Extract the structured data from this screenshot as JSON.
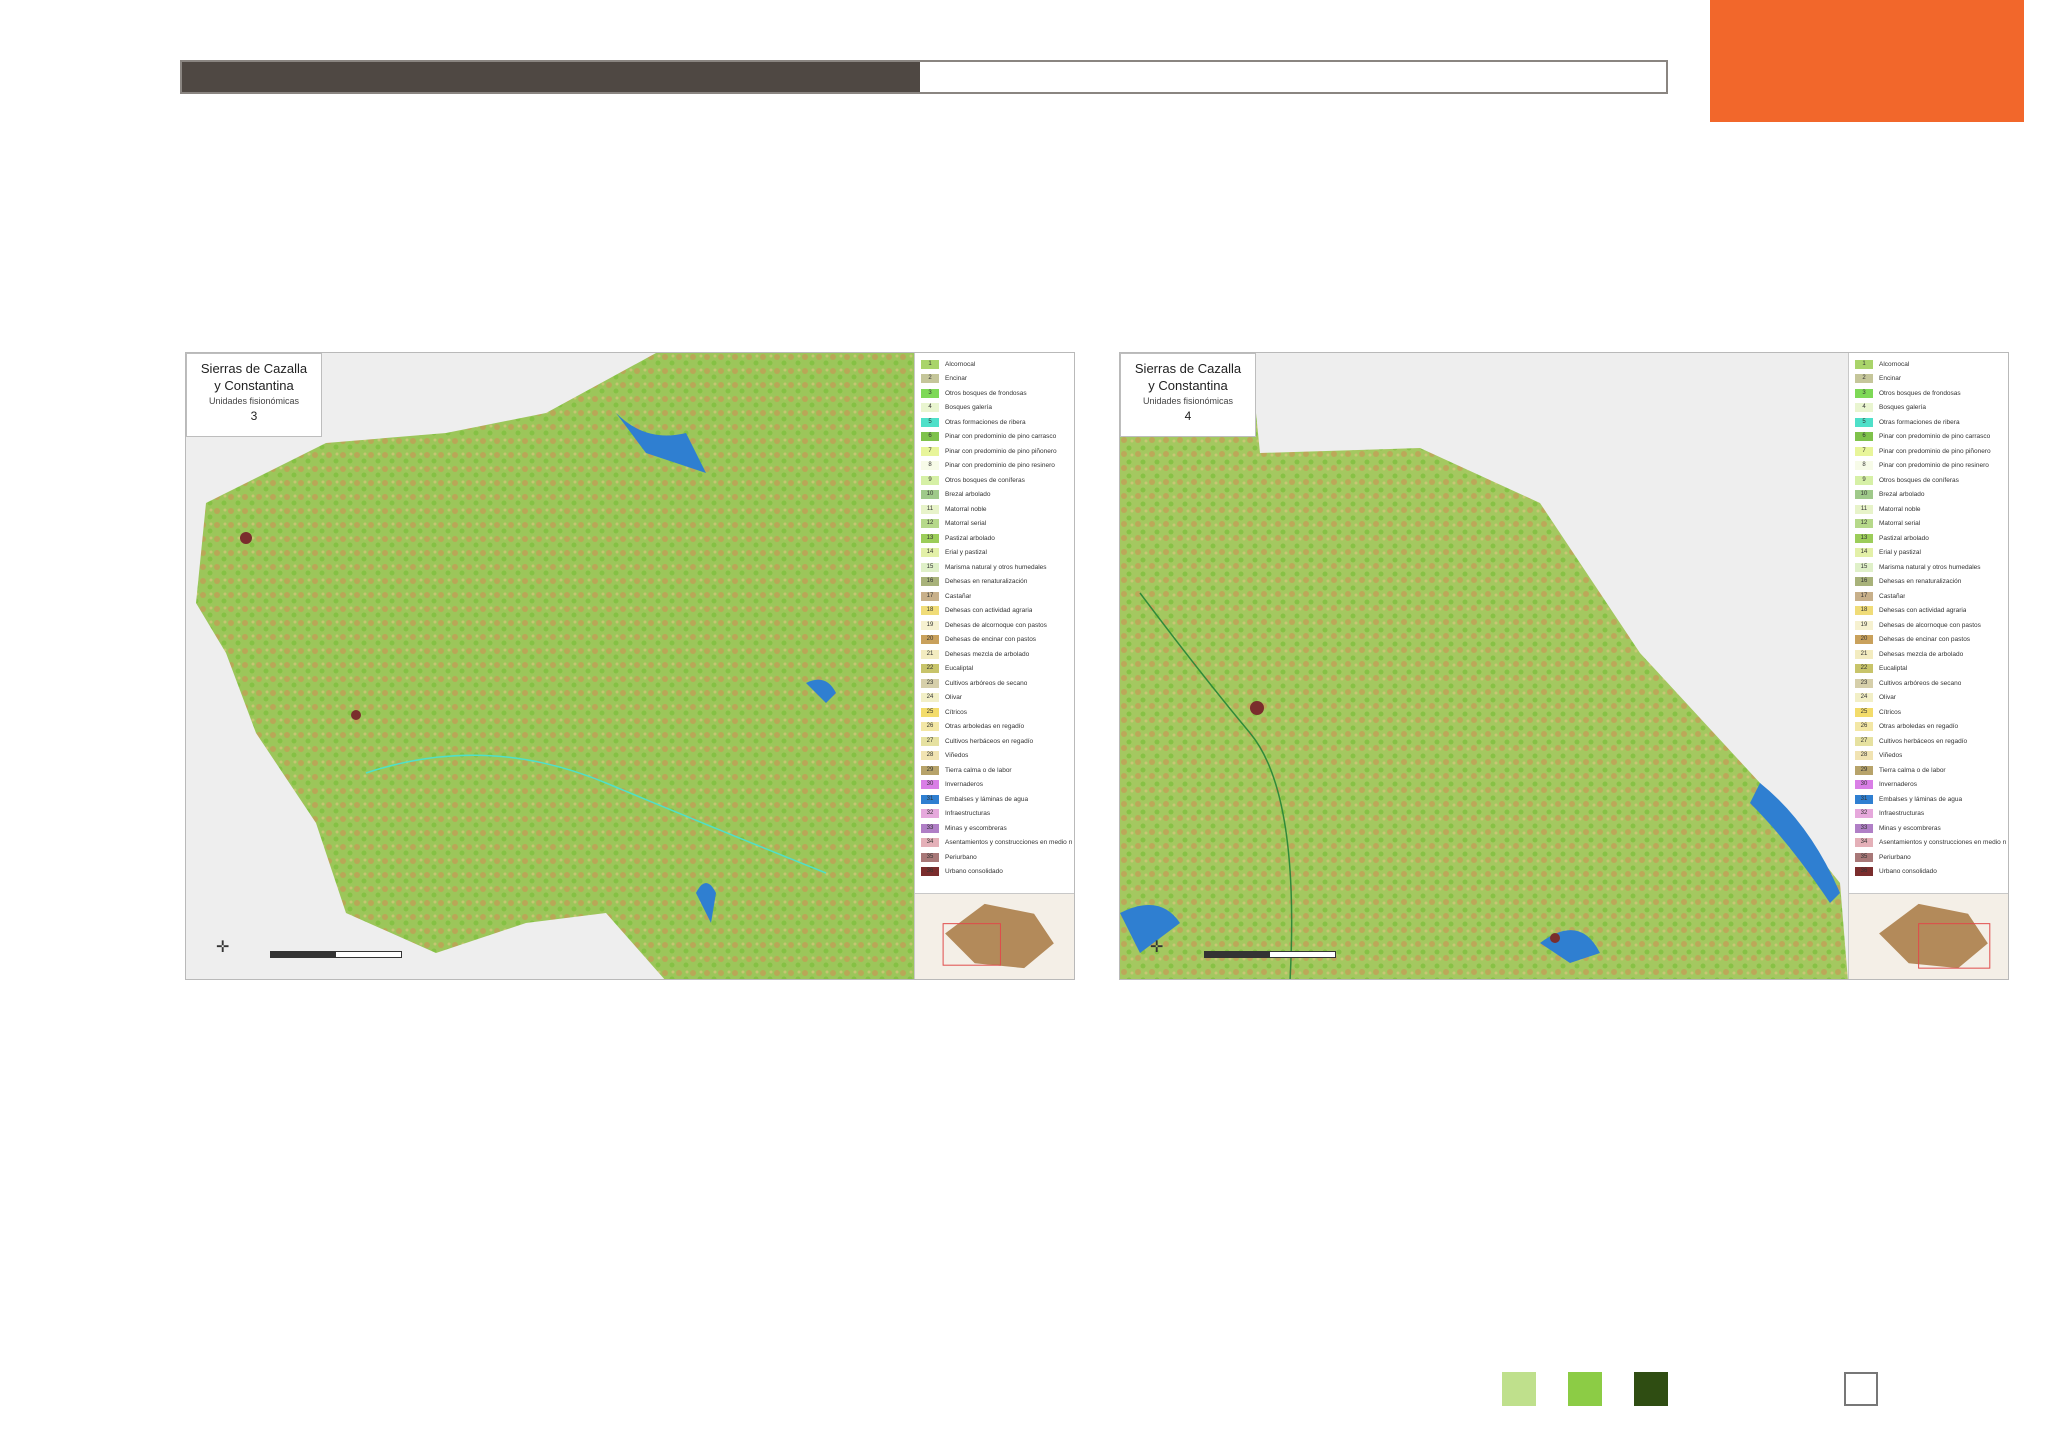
{
  "progress": {
    "fraction": 0.497
  },
  "colors": {
    "accent": "#f2672b",
    "progress_fill": "#4f4843",
    "square_1": "#bfe08c",
    "square_2": "#8ccc45",
    "square_3": "#2f4d12"
  },
  "maps": [
    {
      "title_line1": "Sierras de Cazalla",
      "title_line2": "y Constantina",
      "subtitle": "Unidades fisionómicas",
      "number": "3"
    },
    {
      "title_line1": "Sierras de Cazalla",
      "title_line2": "y Constantina",
      "subtitle": "Unidades fisionómicas",
      "number": "4"
    }
  ],
  "legend": [
    {
      "code": "1",
      "label": "Alcornocal",
      "color": "#a9d46a"
    },
    {
      "code": "2",
      "label": "Encinar",
      "color": "#c5c69a"
    },
    {
      "code": "3",
      "label": "Otros bosques de frondosas",
      "color": "#7ed957"
    },
    {
      "code": "4",
      "label": "Bosques galería",
      "color": "#e9f5d0"
    },
    {
      "code": "5",
      "label": "Otras formaciones de ribera",
      "color": "#4fe0c9"
    },
    {
      "code": "6",
      "label": "Pinar con predominio de pino carrasco",
      "color": "#7fc24b"
    },
    {
      "code": "7",
      "label": "Pinar con predominio de pino piñonero",
      "color": "#e8f59a"
    },
    {
      "code": "8",
      "label": "Pinar con predominio de pino resinero",
      "color": "#f7fbe8"
    },
    {
      "code": "9",
      "label": "Otros bosques de coníferas",
      "color": "#d6f0a6"
    },
    {
      "code": "10",
      "label": "Brezal arbolado",
      "color": "#9fc98a"
    },
    {
      "code": "11",
      "label": "Matorral noble",
      "color": "#e7f3c9"
    },
    {
      "code": "12",
      "label": "Matorral serial",
      "color": "#b6d98a"
    },
    {
      "code": "13",
      "label": "Pastizal arbolado",
      "color": "#9ccd5a"
    },
    {
      "code": "14",
      "label": "Erial y pastizal",
      "color": "#e3f0a8"
    },
    {
      "code": "15",
      "label": "Marisma natural y otros humedales",
      "color": "#dff0c8"
    },
    {
      "code": "16",
      "label": "Dehesas en renaturalización",
      "color": "#a8b27a"
    },
    {
      "code": "17",
      "label": "Castañar",
      "color": "#c8b08a"
    },
    {
      "code": "18",
      "label": "Dehesas con actividad agraria",
      "color": "#f0dc78"
    },
    {
      "code": "19",
      "label": "Dehesas de alcornoque con pastos",
      "color": "#f6f1d0"
    },
    {
      "code": "20",
      "label": "Dehesas de encinar con pastos",
      "color": "#c9a15c"
    },
    {
      "code": "21",
      "label": "Dehesas mezcla de arbolado",
      "color": "#f3ecc0"
    },
    {
      "code": "22",
      "label": "Eucaliptal",
      "color": "#c8c46a"
    },
    {
      "code": "23",
      "label": "Cultivos arbóreos de secano",
      "color": "#d6cfaa"
    },
    {
      "code": "24",
      "label": "Olivar",
      "color": "#f2efc6"
    },
    {
      "code": "25",
      "label": "Cítricos",
      "color": "#f3dc6b"
    },
    {
      "code": "26",
      "label": "Otras arboledas en regadío",
      "color": "#f3e7a5"
    },
    {
      "code": "27",
      "label": "Cultivos herbáceos en regadío",
      "color": "#e6e1a0"
    },
    {
      "code": "28",
      "label": "Viñedos",
      "color": "#f1e3b2"
    },
    {
      "code": "29",
      "label": "Tierra calma o de labor",
      "color": "#b7a36a"
    },
    {
      "code": "30",
      "label": "Invernaderos",
      "color": "#d97ee6"
    },
    {
      "code": "31",
      "label": "Embalses y láminas de agua",
      "color": "#2f7fd1"
    },
    {
      "code": "32",
      "label": "Infraestructuras",
      "color": "#e6a8dc"
    },
    {
      "code": "33",
      "label": "Minas y escombreras",
      "color": "#b07fc6"
    },
    {
      "code": "34",
      "label": "Asentamientos y construcciones en medio rural",
      "color": "#e4b0b8"
    },
    {
      "code": "35",
      "label": "Periurbano",
      "color": "#a87878"
    },
    {
      "code": "36",
      "label": "Urbano consolidado",
      "color": "#7a2d2d"
    }
  ]
}
